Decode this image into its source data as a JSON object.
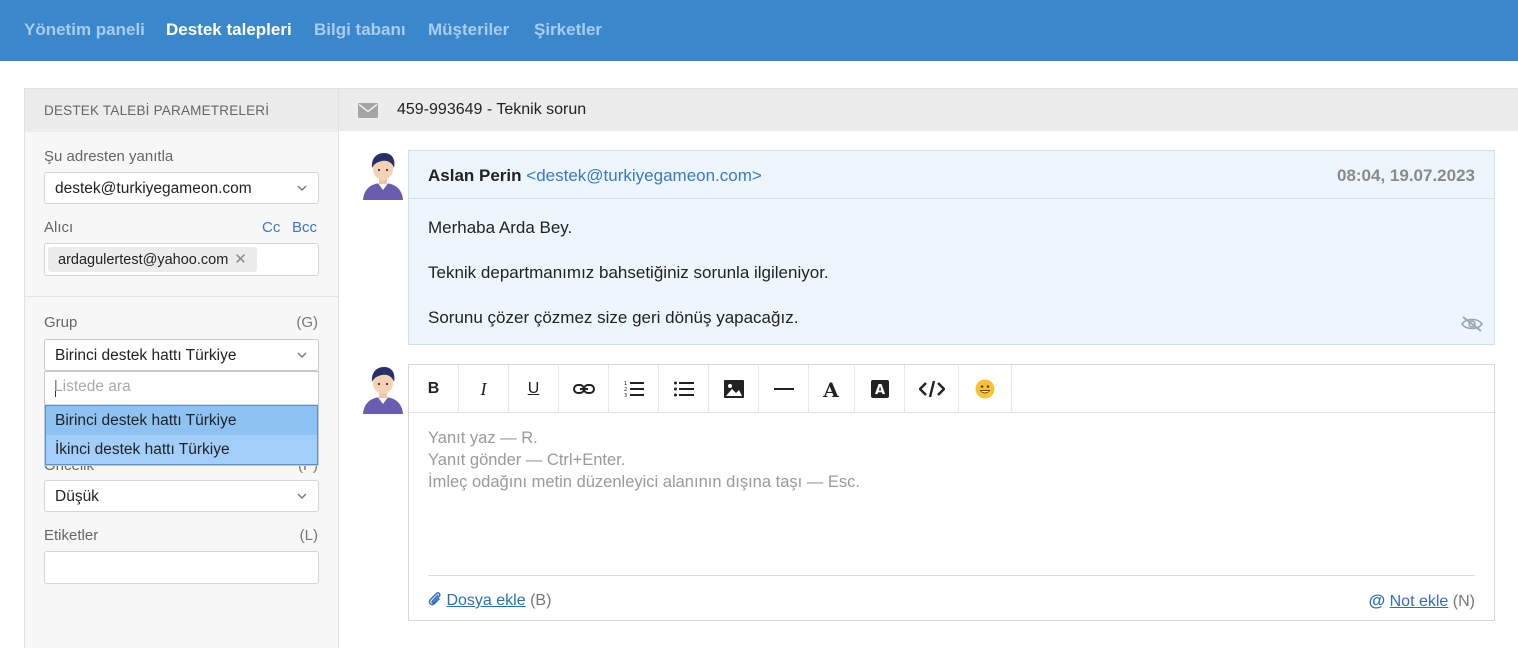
{
  "nav": {
    "items": [
      {
        "label": "Yönetim paneli",
        "active": false
      },
      {
        "label": "Destek talepleri",
        "active": true
      },
      {
        "label": "Bilgi tabanı",
        "active": false
      },
      {
        "label": "Müşteriler",
        "active": false
      },
      {
        "label": "Şirketler",
        "active": false
      }
    ]
  },
  "params": {
    "header": "DESTEK TALEBİ PARAMETRELERİ",
    "reply_from_label": "Şu adresten yanıtla",
    "reply_from_value": "destek@turkiyegameon.com",
    "recipient_label": "Alıcı",
    "cc_label": "Cc",
    "bcc_label": "Bcc",
    "recipient_chip": "ardagulertest@yahoo.com",
    "recipient_chip_remove": "✕",
    "group_label": "Grup",
    "group_hotkey": "(G)",
    "group_value": "Birinci destek hattı Türkiye",
    "group_search_placeholder": "Listede ara",
    "group_options": [
      "Birinci destek hattı Türkiye",
      "İkinci destek hattı Türkiye"
    ],
    "priority_label": "Öncelik",
    "priority_hotkey": "(P)",
    "priority_value": "Düşük",
    "tags_label": "Etiketler",
    "tags_hotkey": "(L)"
  },
  "ticket": {
    "title": "459-993649 - Teknik sorun"
  },
  "message": {
    "author": "Aslan Perin",
    "email": "<destek@turkiyegameon.com>",
    "date": "08:04, 19.07.2023",
    "lines": [
      "Merhaba Arda Bey.",
      "Teknik departmanımız bahsetiğiniz sorunla ilgileniyor.",
      "Sorunu çözer çözmez size geri dönüş yapacağız."
    ]
  },
  "editor": {
    "toolbar": [
      {
        "name": "bold-button",
        "glyph": "B"
      },
      {
        "name": "italic-button",
        "glyph": "I"
      },
      {
        "name": "underline-button",
        "glyph": "U"
      },
      {
        "name": "link-button",
        "glyph": "link-icon"
      },
      {
        "name": "ordered-list-button",
        "glyph": "ordered-list-icon"
      },
      {
        "name": "bullet-list-button",
        "glyph": "bullet-list-icon"
      },
      {
        "name": "image-button",
        "glyph": "image-icon"
      },
      {
        "name": "horizontal-rule-button",
        "glyph": "hr-icon"
      },
      {
        "name": "text-color-button",
        "glyph": "text-color-icon"
      },
      {
        "name": "background-color-button",
        "glyph": "bg-color-icon"
      },
      {
        "name": "code-button",
        "glyph": "code-icon"
      },
      {
        "name": "emoji-button",
        "glyph": "emoji-icon"
      }
    ],
    "hints": [
      "Yanıt yaz — R.",
      "Yanıt gönder — Ctrl+Enter.",
      "İmleç odağını metin düzenleyici alanının dışına taşı — Esc."
    ],
    "attach_label": "Dosya ekle",
    "attach_hotkey": "(B)",
    "note_label": "Not ekle",
    "note_hotkey": "(N)"
  },
  "colors": {
    "nav_bg": "#3b87cc",
    "link": "#3b78c4",
    "message_bg": "#eef6fd",
    "dropdown_option": "#a2cffa"
  }
}
